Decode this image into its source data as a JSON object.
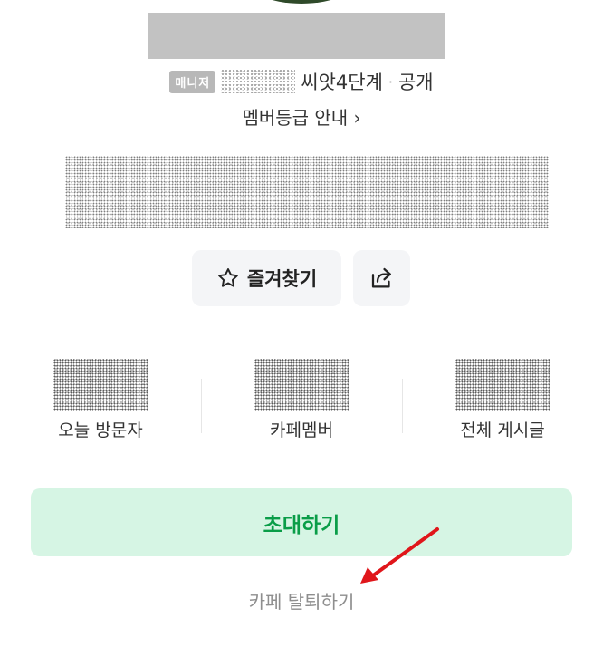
{
  "profile": {
    "badge": "매니저",
    "meta": "씨앗4단계",
    "visibility": "공개",
    "grade_link": "멤버등급 안내 ›"
  },
  "actions": {
    "favorite_label": "즐겨찾기",
    "favorite_icon": "star-outline-icon",
    "share_icon": "share-icon"
  },
  "stats": [
    {
      "label": "오늘 방문자"
    },
    {
      "label": "카페멤버"
    },
    {
      "label": "전체 게시글"
    }
  ],
  "invite_label": "초대하기",
  "leave_label": "카페 탈퇴하기",
  "colors": {
    "invite_bg": "#d6f5e4",
    "invite_text": "#0a9d48",
    "arrow": "#e0161b"
  }
}
